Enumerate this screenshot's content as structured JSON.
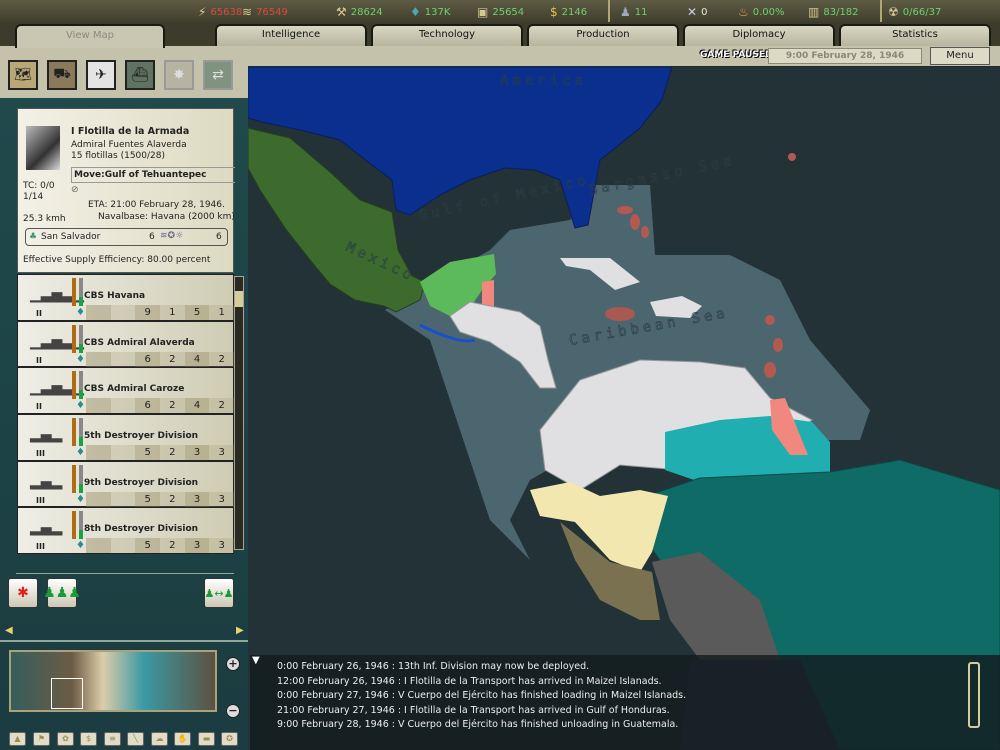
{
  "topbar": {
    "resources": [
      {
        "icon": "energy-icon",
        "glyph": "⚡",
        "value": "65638",
        "color": "red"
      },
      {
        "icon": "metal-icon",
        "glyph": "≋",
        "value": "76549",
        "color": "red"
      },
      {
        "icon": "rare-materials-icon",
        "glyph": "⚒",
        "value": "28624",
        "color": "grn"
      },
      {
        "icon": "oil-icon",
        "glyph": "💧",
        "value": "137K",
        "color": "grn"
      },
      {
        "icon": "supplies-icon",
        "glyph": "▣",
        "value": "25654",
        "color": "grn"
      },
      {
        "icon": "money-icon",
        "glyph": "$",
        "value": "2146",
        "color": "grn"
      },
      {
        "icon": "manpower-icon",
        "glyph": "♟",
        "value": "11",
        "color": "grn"
      },
      {
        "icon": "transports-icon",
        "glyph": "✕",
        "value": "0",
        "color": "wht"
      },
      {
        "icon": "dissent-icon",
        "glyph": "♨",
        "value": "0.00%",
        "color": "grn"
      },
      {
        "icon": "ic-icon",
        "glyph": "▥",
        "value": "83/182",
        "color": "grn"
      },
      {
        "icon": "nuclear-icon",
        "glyph": "☢",
        "value": "0/66/37",
        "color": "grn"
      }
    ]
  },
  "tabs": {
    "view_map": "View Map",
    "items": [
      "Intelligence",
      "Technology",
      "Production",
      "Diplomacy",
      "Statistics"
    ]
  },
  "status": {
    "paused": "GAME PAUSED",
    "date": "9:00 February 28, 1946",
    "menu": "Menu"
  },
  "map_modes": [
    "terrain",
    "land-units",
    "air-units",
    "naval-units",
    "combat",
    "unit-interface"
  ],
  "unit": {
    "name": "I Flotilla de la Armada",
    "commander": "Admiral Fuentes Alaverda",
    "strength": "15 flotillas (1500/28)",
    "order": "Move:Gulf of Tehuantepec",
    "tc": "TC: 0/0",
    "ratio": "1/14",
    "speed": "25.3 kmh",
    "eta": "ETA: 21:00 February 28, 1946.",
    "base": "Navalbase: Havana (2000 km)",
    "location": "San Salvador",
    "loc_left": "6",
    "loc_right": "6",
    "supply": "Effective Supply Efficiency: 80.00 percent"
  },
  "ships": [
    {
      "name": "CBS Havana",
      "class": "II",
      "stats": [
        "",
        "",
        "9",
        "1",
        "5",
        "1"
      ]
    },
    {
      "name": "CBS Admiral Alaverda",
      "class": "II",
      "stats": [
        "",
        "",
        "6",
        "2",
        "4",
        "2"
      ]
    },
    {
      "name": "CBS Admiral Caroze",
      "class": "II",
      "stats": [
        "",
        "",
        "6",
        "2",
        "4",
        "2"
      ]
    },
    {
      "name": "5th Destroyer Division",
      "class": "III",
      "stats": [
        "",
        "",
        "5",
        "2",
        "3",
        "3"
      ]
    },
    {
      "name": "9th Destroyer Division",
      "class": "III",
      "stats": [
        "",
        "",
        "5",
        "2",
        "3",
        "3"
      ]
    },
    {
      "name": "8th Destroyer Division",
      "class": "III",
      "stats": [
        "",
        "",
        "5",
        "2",
        "3",
        "3"
      ]
    }
  ],
  "map_labels": {
    "usa": "America",
    "gulf": "Gulf of Mexico",
    "mexico": "Mexico",
    "caribbean": "Caribbean Sea",
    "sargasso": "Sargasso Sea"
  },
  "log": [
    "0:00 February 26, 1946 : 13th Inf. Division may now be deployed.",
    "12:00 February 26, 1946 : I Flotilla de la Transport has arrived in Maizel Islanads.",
    "0:00 February 27, 1946 : V Cuerpo del Ejército has finished loading in Maizel Islanads.",
    "21:00 February 27, 1946 : I Flotilla de la Transport has arrived in Gulf of Honduras.",
    "9:00 February 28, 1946 : V Cuerpo del Ejército has finished unloading in Guatemala."
  ]
}
